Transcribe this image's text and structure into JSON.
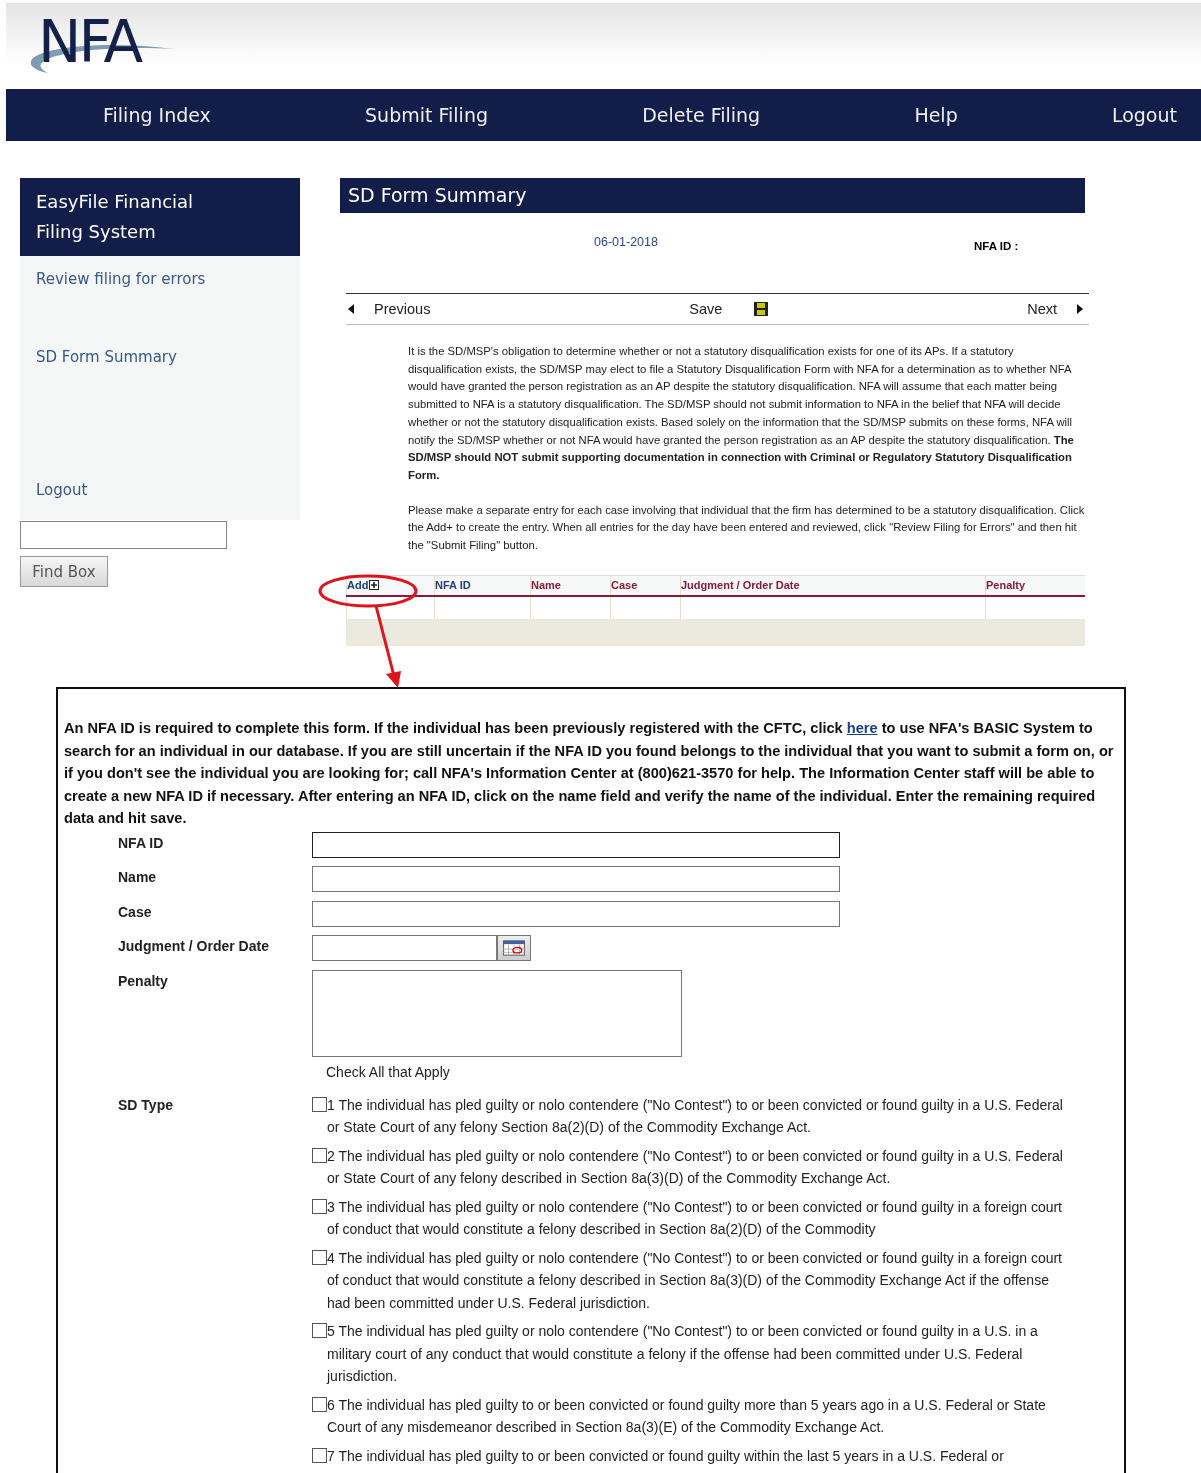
{
  "logo": {
    "text": "NFA"
  },
  "nav": [
    {
      "label": "Filing Index"
    },
    {
      "label": "Submit Filing"
    },
    {
      "label": "Delete Filing"
    },
    {
      "label": "Help"
    },
    {
      "label": "Logout"
    }
  ],
  "sidebar": {
    "title": "EasyFile Financial Filing System",
    "links": [
      {
        "label": "Review filing for errors"
      },
      {
        "label": "SD Form Summary"
      },
      {
        "label": "Logout"
      }
    ],
    "find_button": "Find Box"
  },
  "main": {
    "title": "SD Form Summary",
    "date": "06-01-2018",
    "nfa_id_label": "NFA ID :",
    "pager": {
      "previous": "Previous",
      "save": "Save",
      "next": "Next"
    },
    "intro": "It is the SD/MSP's obligation to determine whether or not a statutory disqualification exists for one of its APs. If a statutory disqualification exists, the SD/MSP may elect to file a Statutory Disqualification Form with NFA for a determination as to whether NFA would have granted the person registration as an AP despite the statutory disqualification. NFA will assume that each matter being submitted to NFA is a statutory disqualification. The SD/MSP should not submit information to NFA in the belief that NFA will decide whether or not the statutory disqualification exists. Based solely on the information that the SD/MSP submits on these forms, NFA will notify the SD/MSP whether or not NFA would have granted the person registration as an AP despite the statutory disqualification. **The SD/MSP should NOT submit supporting documentation in connection with Criminal or Regulatory Statutory Disqualification Form.**",
    "instructions": "Please make a separate entry for each case involving that individual that the firm has determined to be a statutory disqualification. Click the Add+ to create the entry. When all entries for the day have been entered and reviewed, click \"Review Filing for Errors\" and then hit the \"Submit Filing\" button.",
    "table": {
      "columns": [
        {
          "label": "Add",
          "color": "#1c3f7a"
        },
        {
          "label": "NFA ID",
          "color": "#1c3f7a"
        },
        {
          "label": "Name",
          "color": "#8b1a3a"
        },
        {
          "label": "Case",
          "color": "#8b1a3a"
        },
        {
          "label": "Judgment / Order Date",
          "color": "#8b1a3a"
        },
        {
          "label": "Penalty",
          "color": "#8b1a3a"
        }
      ]
    }
  },
  "dialog": {
    "notice_before": "An NFA ID is required to complete this form. If the individual has been previously registered with the CFTC, click",
    "link": "here",
    "notice_after": "to use NFA's BASIC System to search for an individual in our database. If you are still uncertain if the NFA ID you found belongs to the individual that you want to submit a form on, or if you don't see the individual you are looking for; call NFA's Information Center at (800)621-3570 for help. The Information Center staff will be able to create a new NFA ID if necessary. After entering an NFA ID, click on the name field and verify the name of the individual. Enter the remaining required data and hit save.",
    "fields": [
      {
        "label": "NFA ID",
        "kind": "text"
      },
      {
        "label": "Name",
        "kind": "text"
      },
      {
        "label": "Case",
        "kind": "text"
      },
      {
        "label": "Judgment / Order Date",
        "kind": "date"
      },
      {
        "label": "Penalty",
        "kind": "textarea"
      }
    ],
    "check_hint": "Check All that Apply",
    "sd_type_label": "SD Type",
    "sd_types": [
      {
        "text": "1 The individual has pled guilty or nolo contendere (\"No Contest\") to or been convicted or found guilty in a U.S. Federal or State Court of any felony Section 8a(2)(D) of the Commodity Exchange Act.",
        "checked": false
      },
      {
        "text": "2 The individual has pled guilty or nolo contendere (\"No Contest\") to or been convicted or found guilty in a U.S. Federal or State Court of any felony described in Section 8a(3)(D) of the Commodity Exchange Act.",
        "checked": false
      },
      {
        "text": "3 The individual has pled guilty or nolo contendere (\"No Contest\") to or been convicted or found guilty in a foreign court of conduct that would constitute a felony described in Section 8a(2)(D) of the Commodity",
        "checked": false
      },
      {
        "text": "4 The individual has pled guilty or nolo contendere (\"No Contest\") to or been convicted or found guilty in a foreign court of conduct that would constitute a felony described in Section 8a(3)(D) of the Commodity Exchange Act if the offense had been committed under U.S. Federal jurisdiction.",
        "checked": false
      },
      {
        "text": "5 The individual has pled guilty or nolo contendere (\"No Contest\") to or been convicted or found guilty in a U.S. in a military court of any conduct that would constitute a felony if the offense had been committed under U.S. Federal jurisdiction.",
        "checked": false
      },
      {
        "text": "6 The individual has pled guilty to or been convicted or found guilty more than 5 years ago in a U.S. Federal or State Court of any misdemeanor described in Section 8a(3)(E) of the Commodity Exchange Act.",
        "checked": false
      },
      {
        "text": "7 The individual has pled guilty to or been convicted or found guilty within the last 5 years in a U.S. Federal or",
        "checked": false
      }
    ]
  }
}
